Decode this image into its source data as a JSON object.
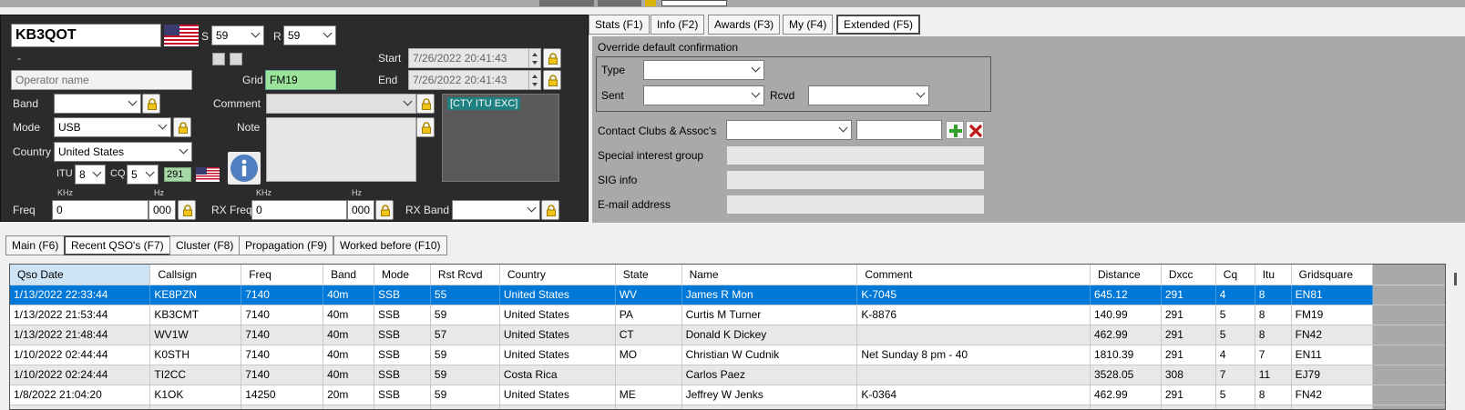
{
  "contact": {
    "callsign": "KB3QOT",
    "s_label": "S",
    "s_value": "59",
    "r_label": "R",
    "r_value": "59",
    "dash": "-",
    "operator_placeholder": "Operator name",
    "start_label": "Start",
    "start_value": "7/26/2022 20:41:43",
    "end_label": "End",
    "end_value": "7/26/2022 20:41:43",
    "grid_label": "Grid",
    "grid_value": "FM19",
    "band_label": "Band",
    "band_value": "",
    "mode_label": "Mode",
    "mode_value": "USB",
    "country_label": "Country",
    "country_value": "United States",
    "comment_label": "Comment",
    "note_label": "Note",
    "cty_badge": "[CTY ITU EXC]",
    "itu_label": "ITU",
    "itu_value": "8",
    "cq_label": "CQ",
    "cq_value": "5",
    "dxcc_value": "291",
    "freq_label": "Freq",
    "khz_label": "KHz",
    "hz_label": "Hz",
    "freq_khz": "0",
    "freq_hz": "000",
    "rx_freq_label": "RX Freq",
    "rx_khz_label": "KHz",
    "rx_hz_label": "Hz",
    "rx_freq_khz": "0",
    "rx_freq_hz": "000",
    "rx_band_label": "RX Band"
  },
  "top_tabs": [
    {
      "label": "Stats (F1)"
    },
    {
      "label": "Info (F2)"
    },
    {
      "label": "Awards (F3)"
    },
    {
      "label": "My (F4)"
    },
    {
      "label": "Extended (F5)"
    }
  ],
  "extended": {
    "override_title": "Override default confirmation",
    "type_label": "Type",
    "sent_label": "Sent",
    "rcvd_label": "Rcvd",
    "clubs_label": "Contact Clubs & Assoc's",
    "sig_label": "Special interest group",
    "sig_info_label": "SIG info",
    "email_label": "E-mail address"
  },
  "bottom_tabs": [
    {
      "label": "Main (F6)"
    },
    {
      "label": "Recent QSO's (F7)"
    },
    {
      "label": "Cluster (F8)"
    },
    {
      "label": "Propagation (F9)"
    },
    {
      "label": "Worked before (F10)"
    }
  ],
  "qso_table": {
    "columns": [
      "Qso Date",
      "Callsign",
      "Freq",
      "Band",
      "Mode",
      "Rst Rcvd",
      "Country",
      "State",
      "Name",
      "Comment",
      "Distance",
      "Dxcc",
      "Cq",
      "Itu",
      "Gridsquare"
    ],
    "rows": [
      [
        "1/13/2022 22:33:44",
        "KE8PZN",
        "7140",
        "40m",
        "SSB",
        "55",
        "United States",
        "WV",
        "James R Mon",
        "K-7045",
        "645.12",
        "291",
        "4",
        "8",
        "EN81"
      ],
      [
        "1/13/2022 21:53:44",
        "KB3CMT",
        "7140",
        "40m",
        "SSB",
        "59",
        "United States",
        "PA",
        "Curtis M Turner",
        "K-8876",
        "140.99",
        "291",
        "5",
        "8",
        "FM19"
      ],
      [
        "1/13/2022 21:48:44",
        "WV1W",
        "7140",
        "40m",
        "SSB",
        "57",
        "United States",
        "CT",
        "Donald K Dickey",
        "",
        "462.99",
        "291",
        "5",
        "8",
        "FN42"
      ],
      [
        "1/10/2022 02:44:44",
        "K0STH",
        "7140",
        "40m",
        "SSB",
        "59",
        "United States",
        "MO",
        "Christian W Cudnik",
        "Net Sunday 8 pm - 40",
        "1810.39",
        "291",
        "4",
        "7",
        "EN11"
      ],
      [
        "1/10/2022 02:24:44",
        "TI2CC",
        "7140",
        "40m",
        "SSB",
        "59",
        "Costa Rica",
        "",
        "Carlos Paez",
        "",
        "3528.05",
        "308",
        "7",
        "11",
        "EJ79"
      ],
      [
        "1/8/2022 21:04:20",
        "K1OK",
        "14250",
        "20m",
        "SSB",
        "59",
        "United States",
        "ME",
        "Jeffrey W Jenks",
        "K-0364",
        "462.99",
        "291",
        "5",
        "8",
        "FN42"
      ],
      [
        "",
        "",
        "",
        "",
        "",
        "",
        "",
        "",
        "",
        "",
        "",
        "",
        "",
        "",
        ""
      ]
    ]
  },
  "colors": {
    "dark_panel": "#2b2b2b",
    "selection": "#0078d7",
    "grid_green": "#9be39b",
    "cty_badge": "#1e8080"
  }
}
